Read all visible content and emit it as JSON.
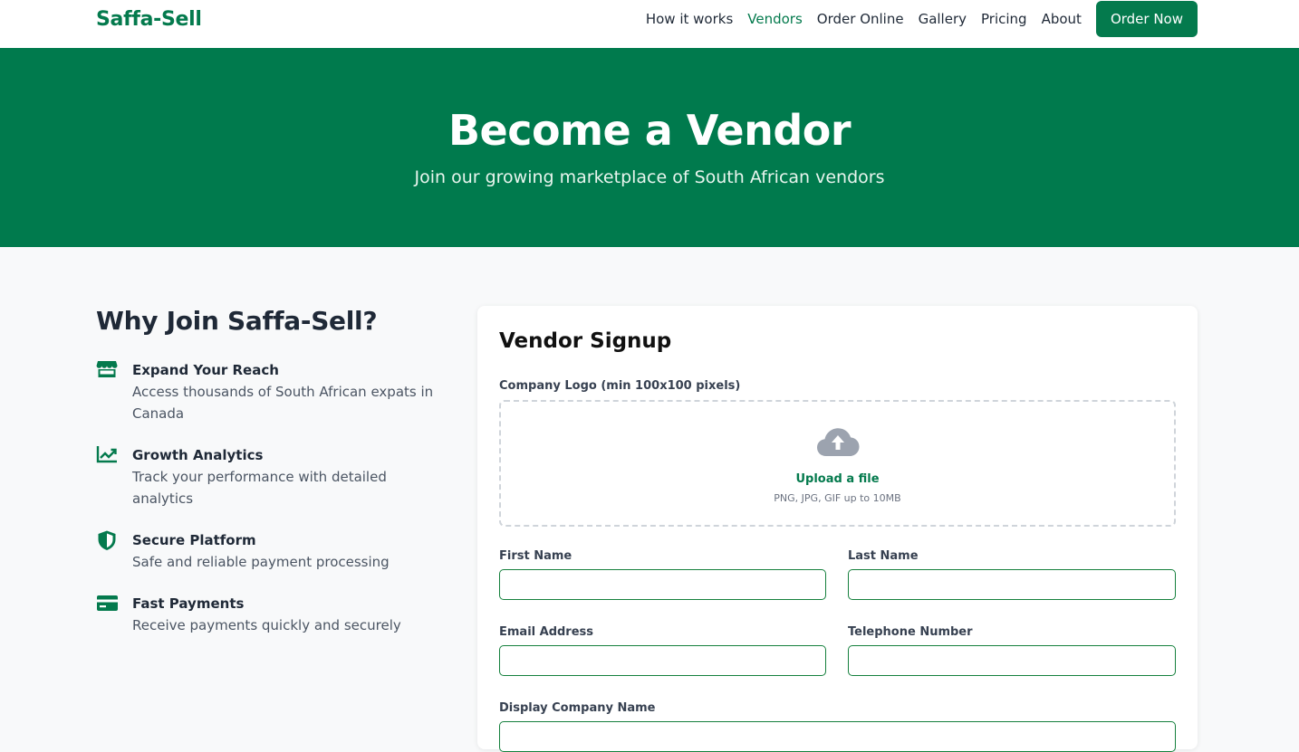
{
  "nav": {
    "brand": "Saffa-Sell",
    "links": [
      "How it works",
      "Vendors",
      "Order Online",
      "Gallery",
      "Pricing",
      "About"
    ],
    "cta": "Order Now"
  },
  "hero": {
    "title": "Become a Vendor",
    "subtitle": "Join our growing marketplace of South African vendors"
  },
  "why": {
    "title": "Why Join Saffa-Sell?",
    "features": [
      {
        "icon": "store-icon",
        "title": "Expand Your Reach",
        "desc": "Access thousands of South African expats in Canada"
      },
      {
        "icon": "chart-line-icon",
        "title": "Growth Analytics",
        "desc": "Track your performance with detailed analytics"
      },
      {
        "icon": "shield-icon",
        "title": "Secure Platform",
        "desc": "Safe and reliable payment processing"
      },
      {
        "icon": "credit-card-icon",
        "title": "Fast Payments",
        "desc": "Receive payments quickly and securely"
      }
    ]
  },
  "form": {
    "title": "Vendor Signup",
    "logo_label": "Company Logo (min 100x100 pixels)",
    "upload_text": "Upload a file",
    "upload_hint": "PNG, JPG, GIF up to 10MB",
    "first_name_label": "First Name",
    "first_name_value": "",
    "last_name_label": "Last Name",
    "last_name_value": "",
    "email_label": "Email Address",
    "email_value": "",
    "phone_label": "Telephone Number",
    "phone_value": "",
    "company_label": "Display Company Name",
    "company_value": ""
  },
  "colors": {
    "brand": "#047a4d",
    "hero_bg": "#007a4d",
    "page_bg": "#f8f9fa"
  }
}
